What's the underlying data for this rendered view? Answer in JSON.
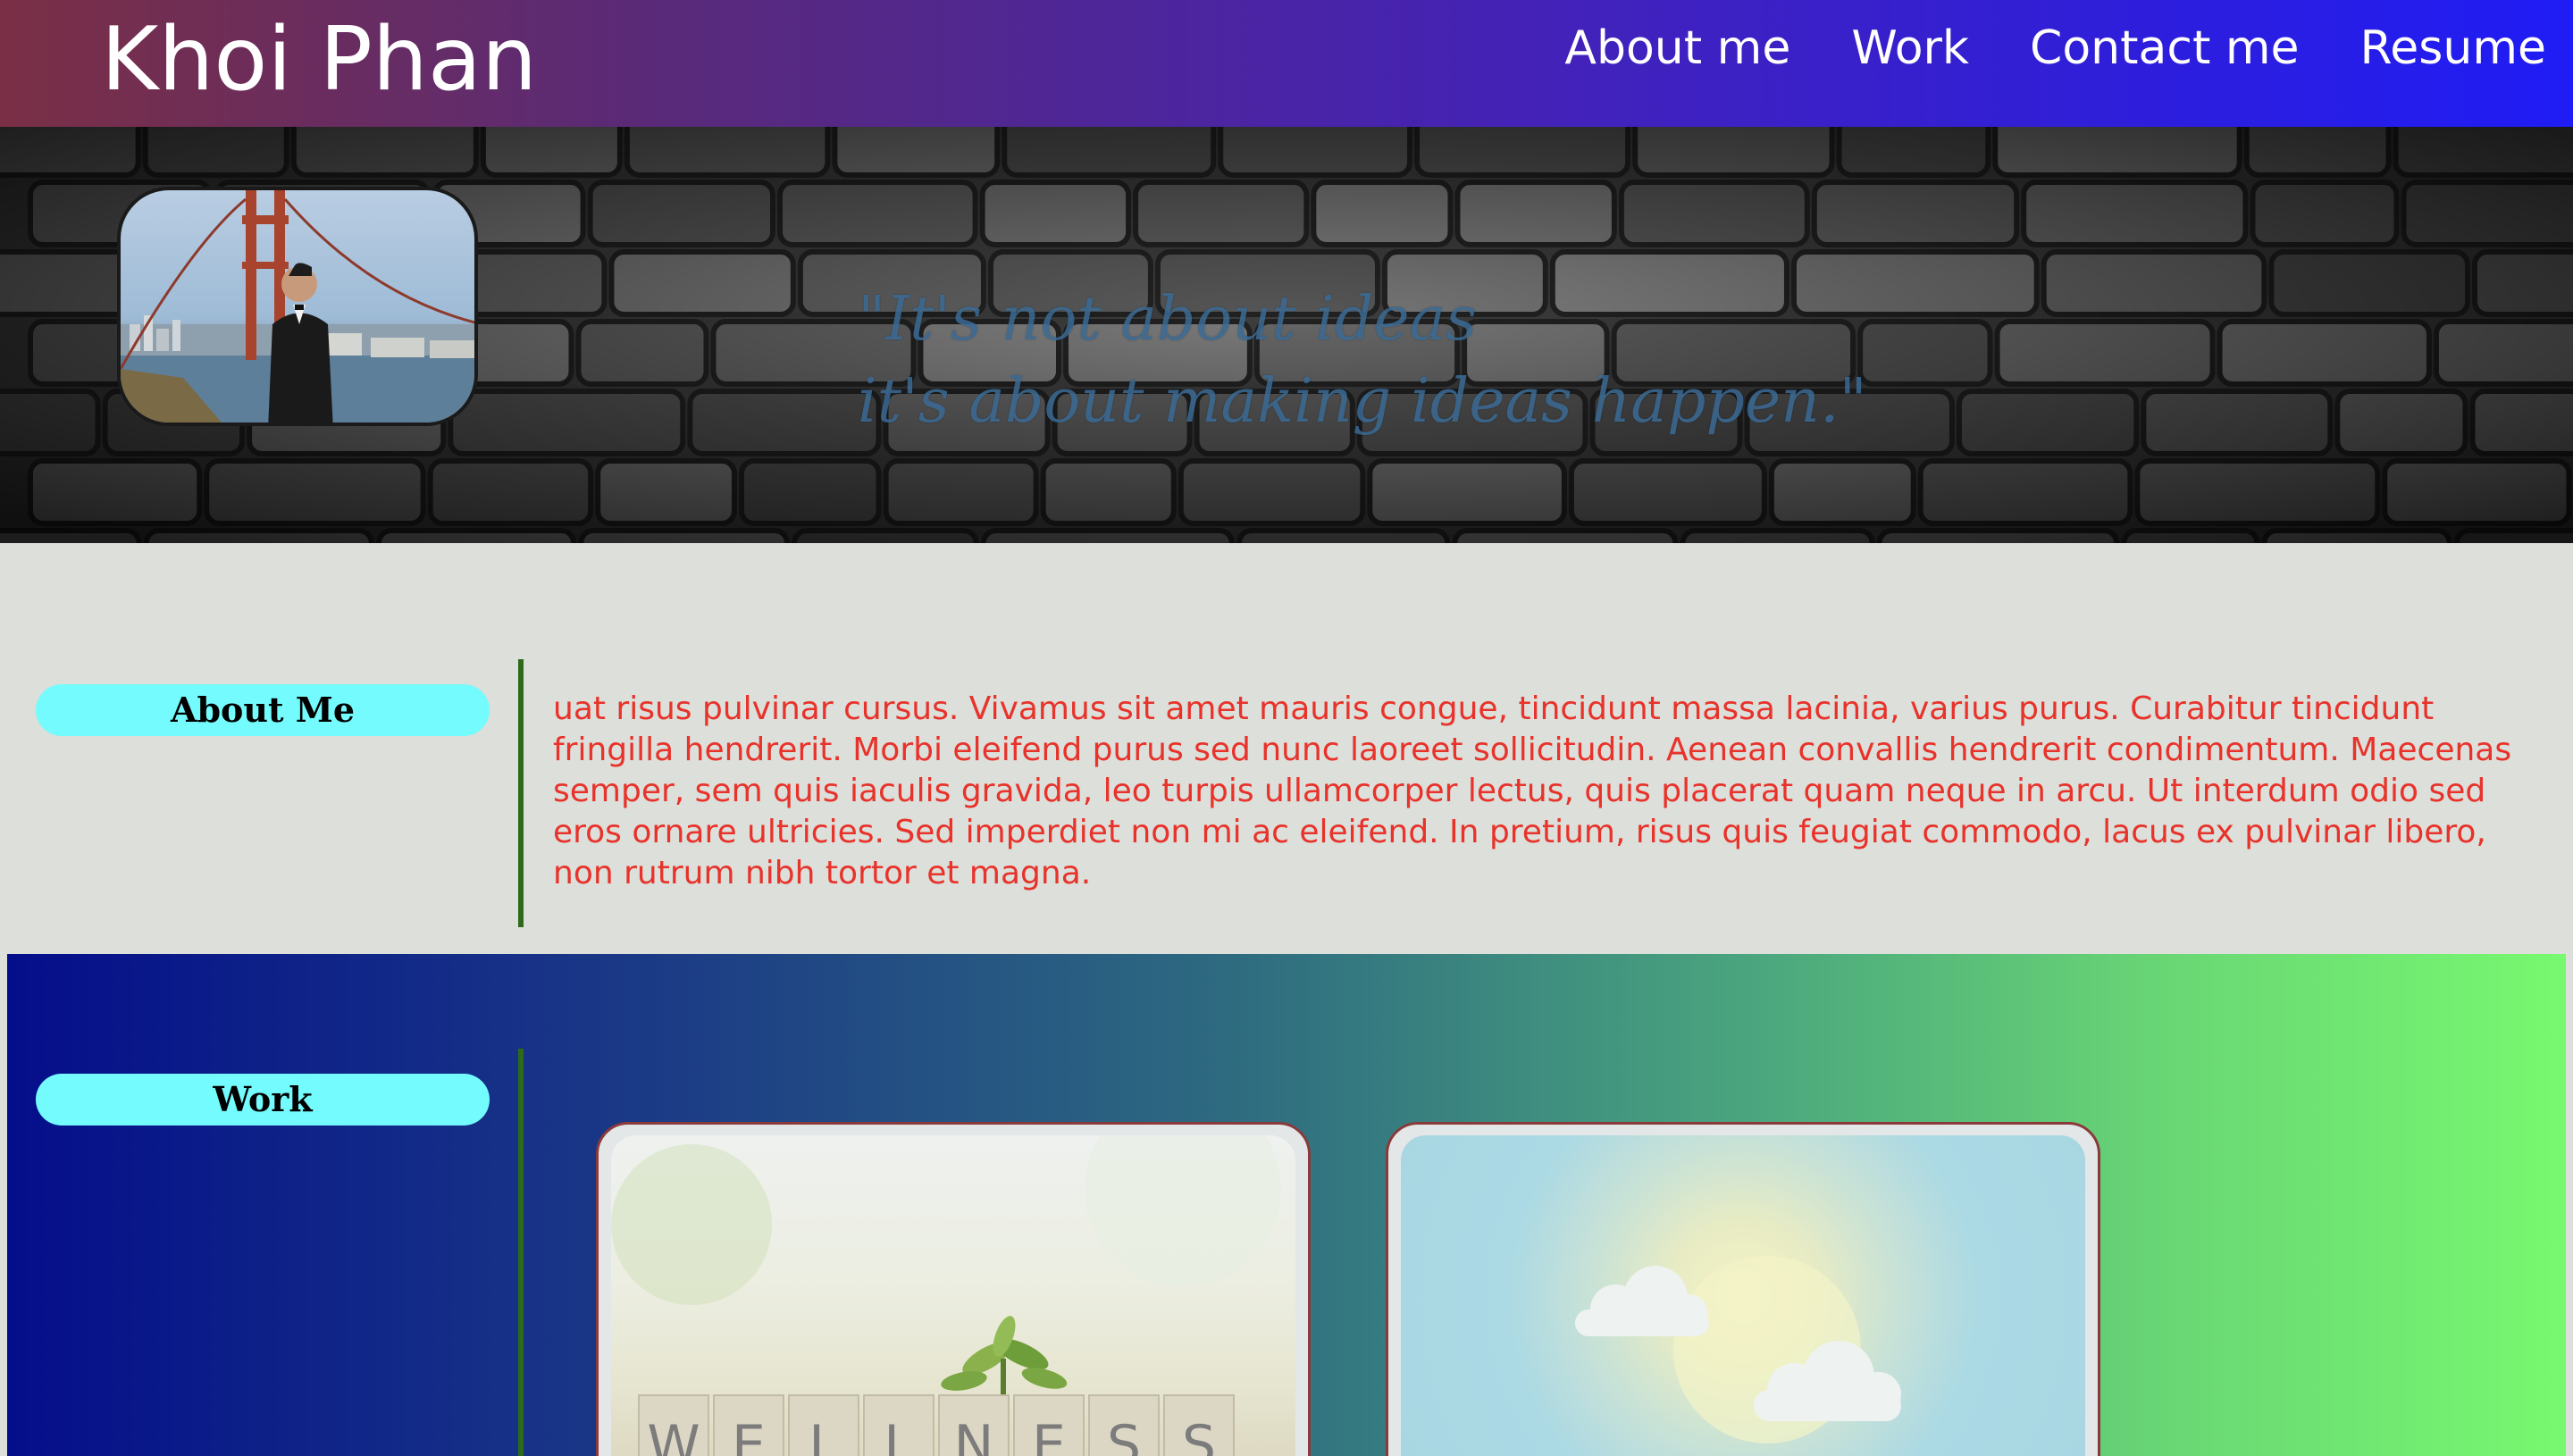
{
  "header": {
    "title": "Khoi Phan",
    "nav": [
      "About me",
      "Work",
      "Contact me",
      "Resume"
    ]
  },
  "hero": {
    "quote_line1": "\"It's not about ideas",
    "quote_line2": "it's about making ideas happen.\""
  },
  "about": {
    "heading": "About Me",
    "text": "uat risus pulvinar cursus. Vivamus sit amet mauris congue, tincidunt massa lacinia, varius purus. Curabitur tincidunt fringilla hendrerit. Morbi eleifend purus sed nunc laoreet sollicitudin. Aenean convallis hendrerit condimentum. Maecenas semper, sem quis iaculis gravida, leo turpis ullamcorper lectus, quis placerat quam neque in arcu. Ut interdum odio sed eros ornare ultricies. Sed imperdiet non mi ac eleifend. In pretium, risus quis feugiat commodo, lacus ex pulvinar libero, non rutrum nibh tortor et magna."
  },
  "work": {
    "heading": "Work",
    "cards": [
      {
        "image_text": "WELLNESS"
      },
      {
        "image_text": ""
      }
    ]
  },
  "colors": {
    "header_start": "#7a2f45",
    "header_end": "#1f1cf5",
    "pill": "#74fbfd",
    "about_text": "#e8322a",
    "divider": "#2d6b18",
    "work_start": "#040e8a",
    "work_end": "#78f870"
  }
}
